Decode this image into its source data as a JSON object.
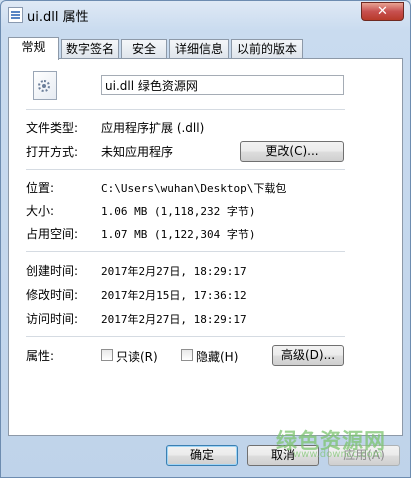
{
  "window": {
    "title": "ui.dll 属性",
    "close_label": "✕"
  },
  "tabs": [
    {
      "label": "常规",
      "active": true
    },
    {
      "label": "数字签名"
    },
    {
      "label": "安全"
    },
    {
      "label": "详细信息"
    },
    {
      "label": "以前的版本"
    }
  ],
  "file": {
    "name": "ui.dll 绿色资源网"
  },
  "info": {
    "type_label": "文件类型:",
    "type_value": "应用程序扩展 (.dll)",
    "open_label": "打开方式:",
    "open_value": "未知应用程序",
    "change_button": "更改(C)...",
    "location_label": "位置:",
    "location_value": "C:\\Users\\wuhan\\Desktop\\下载包",
    "size_label": "大小:",
    "size_value": "1.06 MB (1,118,232 字节)",
    "disk_label": "占用空间:",
    "disk_value": "1.07 MB (1,122,304 字节)",
    "created_label": "创建时间:",
    "created_value": "2017年2月27日, 18:29:17",
    "modified_label": "修改时间:",
    "modified_value": "2017年2月15日, 17:36:12",
    "accessed_label": "访问时间:",
    "accessed_value": "2017年2月27日, 18:29:17"
  },
  "attributes": {
    "label": "属性:",
    "readonly_label": "只读(R)",
    "readonly_checked": false,
    "hidden_label": "隐藏(H)",
    "hidden_checked": false,
    "advanced_button": "高级(D)..."
  },
  "footer": {
    "ok": "确定",
    "cancel": "取消",
    "apply": "应用(A)"
  },
  "watermark": {
    "text": "绿色资源网",
    "url": "www.downcc.com"
  }
}
